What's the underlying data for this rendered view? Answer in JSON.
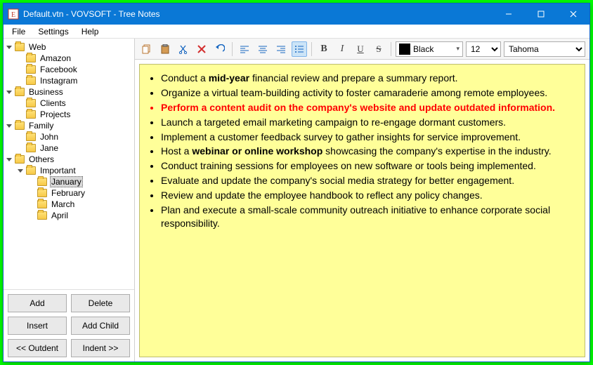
{
  "window": {
    "title": "Default.vtn - VOVSOFT - Tree Notes"
  },
  "menu": {
    "file": "File",
    "settings": "Settings",
    "help": "Help"
  },
  "tree": [
    {
      "level": 0,
      "expander": "down",
      "label": "Web"
    },
    {
      "level": 1,
      "expander": "none",
      "label": "Amazon"
    },
    {
      "level": 1,
      "expander": "none",
      "label": "Facebook"
    },
    {
      "level": 1,
      "expander": "none",
      "label": "Instagram"
    },
    {
      "level": 0,
      "expander": "down",
      "label": "Business"
    },
    {
      "level": 1,
      "expander": "none",
      "label": "Clients"
    },
    {
      "level": 1,
      "expander": "none",
      "label": "Projects"
    },
    {
      "level": 0,
      "expander": "down",
      "label": "Family"
    },
    {
      "level": 1,
      "expander": "none",
      "label": "John"
    },
    {
      "level": 1,
      "expander": "none",
      "label": "Jane"
    },
    {
      "level": 0,
      "expander": "down",
      "label": "Others"
    },
    {
      "level": 1,
      "expander": "down",
      "label": "Important"
    },
    {
      "level": 2,
      "expander": "none",
      "label": "January",
      "selected": true
    },
    {
      "level": 2,
      "expander": "none",
      "label": "February"
    },
    {
      "level": 2,
      "expander": "none",
      "label": "March"
    },
    {
      "level": 2,
      "expander": "none",
      "label": "April"
    }
  ],
  "sidebar_buttons": {
    "add": "Add",
    "delete": "Delete",
    "insert": "Insert",
    "add_child": "Add Child",
    "outdent": "<< Outdent",
    "indent": "Indent >>"
  },
  "toolbar": {
    "color_name": "Black",
    "font_size": "12",
    "font_family": "Tahoma"
  },
  "notes": [
    {
      "html": "Conduct a <b>mid-year</b> financial review and prepare a summary report."
    },
    {
      "html": "Organize a virtual team-building activity to foster camaraderie among remote employees."
    },
    {
      "html": "Perform a content audit on the company's website and update outdated information.",
      "red": true
    },
    {
      "html": "Launch a targeted email marketing campaign to re-engage dormant customers."
    },
    {
      "html": "Implement a customer feedback survey to gather insights for service improvement."
    },
    {
      "html": "Host a <b>webinar or online workshop</b> showcasing the company's expertise in the industry."
    },
    {
      "html": "Conduct training sessions for employees on new software or tools being implemented."
    },
    {
      "html": "Evaluate and update the company's social media strategy for better engagement."
    },
    {
      "html": "Review and update the employee handbook to reflect any policy changes."
    },
    {
      "html": "Plan and execute a small-scale community outreach initiative to enhance corporate social responsibility."
    }
  ]
}
